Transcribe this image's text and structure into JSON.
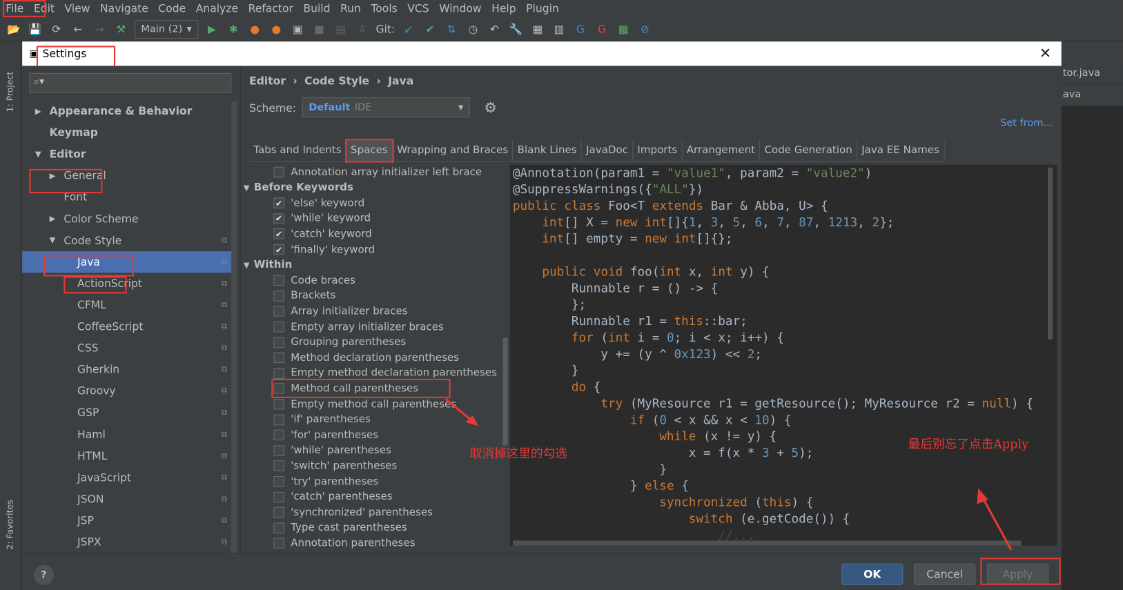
{
  "menu": [
    "File",
    "Edit",
    "View",
    "Navigate",
    "Code",
    "Analyze",
    "Refactor",
    "Build",
    "Run",
    "Tools",
    "VCS",
    "Window",
    "Help",
    "Plugin"
  ],
  "toolbar": {
    "run_config": "Main (2)",
    "git_label": "Git:"
  },
  "left_strip": {
    "project": "1: Project",
    "favorites": "2: Favorites"
  },
  "right_tabs": [
    "tor.java",
    "ava"
  ],
  "dialog": {
    "title": "Settings",
    "close": "✕"
  },
  "sidebar": {
    "items": [
      {
        "label": "Appearance & Behavior",
        "bold": true,
        "arrow": "▶",
        "indent": 0
      },
      {
        "label": "Keymap",
        "bold": true,
        "indent": 0
      },
      {
        "label": "Editor",
        "bold": true,
        "arrow": "▼",
        "indent": 0
      },
      {
        "label": "General",
        "arrow": "▶",
        "indent": 1
      },
      {
        "label": "Font",
        "indent": 1
      },
      {
        "label": "Color Scheme",
        "arrow": "▶",
        "indent": 1
      },
      {
        "label": "Code Style",
        "arrow": "▼",
        "indent": 1,
        "copy": true
      },
      {
        "label": "Java",
        "indent": 2,
        "copy": true,
        "selected": true
      },
      {
        "label": "ActionScript",
        "indent": 2,
        "copy": true
      },
      {
        "label": "CFML",
        "indent": 2,
        "copy": true
      },
      {
        "label": "CoffeeScript",
        "indent": 2,
        "copy": true
      },
      {
        "label": "CSS",
        "indent": 2,
        "copy": true
      },
      {
        "label": "Gherkin",
        "indent": 2,
        "copy": true
      },
      {
        "label": "Groovy",
        "indent": 2,
        "copy": true
      },
      {
        "label": "GSP",
        "indent": 2,
        "copy": true
      },
      {
        "label": "Haml",
        "indent": 2,
        "copy": true
      },
      {
        "label": "HTML",
        "indent": 2,
        "copy": true
      },
      {
        "label": "JavaScript",
        "indent": 2,
        "copy": true
      },
      {
        "label": "JSON",
        "indent": 2,
        "copy": true
      },
      {
        "label": "JSP",
        "indent": 2,
        "copy": true
      },
      {
        "label": "JSPX",
        "indent": 2,
        "copy": true
      }
    ]
  },
  "breadcrumb": [
    "Editor",
    "Code Style",
    "Java"
  ],
  "scheme": {
    "label": "Scheme:",
    "value": "Default",
    "sub": "IDE"
  },
  "set_from": "Set from...",
  "tabs": [
    {
      "label": "Tabs and Indents"
    },
    {
      "label": "Spaces",
      "active": true
    },
    {
      "label": "Wrapping and Braces"
    },
    {
      "label": "Blank Lines"
    },
    {
      "label": "JavaDoc"
    },
    {
      "label": "Imports"
    },
    {
      "label": "Arrangement"
    },
    {
      "label": "Code Generation"
    },
    {
      "label": "Java EE Names"
    }
  ],
  "options": [
    {
      "label": "Annotation array initializer left brace",
      "checked": false
    },
    {
      "label": "Before Keywords",
      "group": true
    },
    {
      "label": "'else' keyword",
      "checked": true
    },
    {
      "label": "'while' keyword",
      "checked": true
    },
    {
      "label": "'catch' keyword",
      "checked": true
    },
    {
      "label": "'finally' keyword",
      "checked": true
    },
    {
      "label": "Within",
      "group": true
    },
    {
      "label": "Code braces",
      "checked": false
    },
    {
      "label": "Brackets",
      "checked": false
    },
    {
      "label": "Array initializer braces",
      "checked": false
    },
    {
      "label": "Empty array initializer braces",
      "checked": false
    },
    {
      "label": "Grouping parentheses",
      "checked": false
    },
    {
      "label": "Method declaration parentheses",
      "checked": false
    },
    {
      "label": "Empty method declaration parentheses",
      "checked": false
    },
    {
      "label": "Method call parentheses",
      "checked": false
    },
    {
      "label": "Empty method call parentheses",
      "checked": false
    },
    {
      "label": "'if' parentheses",
      "checked": false
    },
    {
      "label": "'for' parentheses",
      "checked": false
    },
    {
      "label": "'while' parentheses",
      "checked": false
    },
    {
      "label": "'switch' parentheses",
      "checked": false
    },
    {
      "label": "'try' parentheses",
      "checked": false
    },
    {
      "label": "'catch' parentheses",
      "checked": false
    },
    {
      "label": "'synchronized' parentheses",
      "checked": false
    },
    {
      "label": "Type cast parentheses",
      "checked": false
    },
    {
      "label": "Annotation parentheses",
      "checked": false
    }
  ],
  "code": [
    [
      [
        "@Annotation(param1 = ",
        ""
      ],
      [
        "\"value1\"",
        "s"
      ],
      [
        ", param2 = ",
        ""
      ],
      [
        "\"value2\"",
        "s"
      ],
      [
        ")",
        ""
      ]
    ],
    [
      [
        "@SuppressWarnings({",
        ""
      ],
      [
        "\"ALL\"",
        "s"
      ],
      [
        "})",
        ""
      ]
    ],
    [
      [
        "public class ",
        "k"
      ],
      [
        "Foo<T ",
        ""
      ],
      [
        "extends ",
        "k"
      ],
      [
        "Bar & Abba, U> {",
        ""
      ]
    ],
    [
      [
        "    int",
        "k"
      ],
      [
        "[] X = ",
        ""
      ],
      [
        "new int",
        "k"
      ],
      [
        "[]{",
        ""
      ],
      [
        "1",
        "n"
      ],
      [
        ", ",
        ""
      ],
      [
        "3",
        "n"
      ],
      [
        ", ",
        ""
      ],
      [
        "5",
        "n"
      ],
      [
        ", ",
        ""
      ],
      [
        "6",
        "n"
      ],
      [
        ", ",
        ""
      ],
      [
        "7",
        "n"
      ],
      [
        ", ",
        ""
      ],
      [
        "87",
        "n"
      ],
      [
        ", ",
        ""
      ],
      [
        "1213",
        "n"
      ],
      [
        ", ",
        ""
      ],
      [
        "2",
        "n"
      ],
      [
        "};",
        ""
      ]
    ],
    [
      [
        "    int",
        "k"
      ],
      [
        "[] empty = ",
        ""
      ],
      [
        "new int",
        "k"
      ],
      [
        "[]{};",
        ""
      ]
    ],
    [
      [
        "",
        ""
      ]
    ],
    [
      [
        "    public void ",
        "k"
      ],
      [
        "foo(",
        ""
      ],
      [
        "int ",
        "k"
      ],
      [
        "x, ",
        ""
      ],
      [
        "int ",
        "k"
      ],
      [
        "y) {",
        ""
      ]
    ],
    [
      [
        "        Runnable r = () -> {",
        ""
      ]
    ],
    [
      [
        "        };",
        ""
      ]
    ],
    [
      [
        "        Runnable r1 = ",
        ""
      ],
      [
        "this",
        "k"
      ],
      [
        "::bar;",
        ""
      ]
    ],
    [
      [
        "        for ",
        "k"
      ],
      [
        "(",
        ""
      ],
      [
        "int ",
        "k"
      ],
      [
        "i = ",
        ""
      ],
      [
        "0",
        "n"
      ],
      [
        "; i < x; i++) {",
        ""
      ]
    ],
    [
      [
        "            y += (y ^ ",
        ""
      ],
      [
        "0x123",
        "n"
      ],
      [
        ") << ",
        ""
      ],
      [
        "2",
        "n"
      ],
      [
        ";",
        ""
      ]
    ],
    [
      [
        "        }",
        ""
      ]
    ],
    [
      [
        "        do ",
        "k"
      ],
      [
        "{",
        ""
      ]
    ],
    [
      [
        "            try ",
        "k"
      ],
      [
        "(MyResource r1 = getResource(); MyResource r2 = ",
        ""
      ],
      [
        "null",
        "k"
      ],
      [
        ") {",
        ""
      ]
    ],
    [
      [
        "                if ",
        "k"
      ],
      [
        "(",
        ""
      ],
      [
        "0",
        "n"
      ],
      [
        " < x && x < ",
        ""
      ],
      [
        "10",
        "n"
      ],
      [
        ") {",
        ""
      ]
    ],
    [
      [
        "                    while ",
        "k"
      ],
      [
        "(x != y) {",
        ""
      ]
    ],
    [
      [
        "                        x = f(x * ",
        ""
      ],
      [
        "3",
        "n"
      ],
      [
        " + ",
        ""
      ],
      [
        "5",
        "n"
      ],
      [
        ");",
        ""
      ]
    ],
    [
      [
        "                    }",
        ""
      ]
    ],
    [
      [
        "                } ",
        ""
      ],
      [
        "else ",
        "k"
      ],
      [
        "{",
        ""
      ]
    ],
    [
      [
        "                    synchronized ",
        "k"
      ],
      [
        "(",
        ""
      ],
      [
        "this",
        "k"
      ],
      [
        ") {",
        ""
      ]
    ],
    [
      [
        "                        switch ",
        "k"
      ],
      [
        "(e.getCode()) {",
        ""
      ]
    ],
    [
      [
        "                            //...",
        "w"
      ]
    ],
    [
      [
        "                        }",
        ""
      ]
    ]
  ],
  "annotations": {
    "uncheck": "取消掉这里的勾选",
    "apply_hint": "最后别忘了点击Apply"
  },
  "footer": {
    "help": "?",
    "ok": "OK",
    "cancel": "Cancel",
    "apply": "Apply"
  },
  "colors": {
    "accent": "#4b6eaf",
    "annotation": "#e53935",
    "keyword": "#cc7832",
    "string": "#6a8759",
    "number": "#6897bb"
  }
}
